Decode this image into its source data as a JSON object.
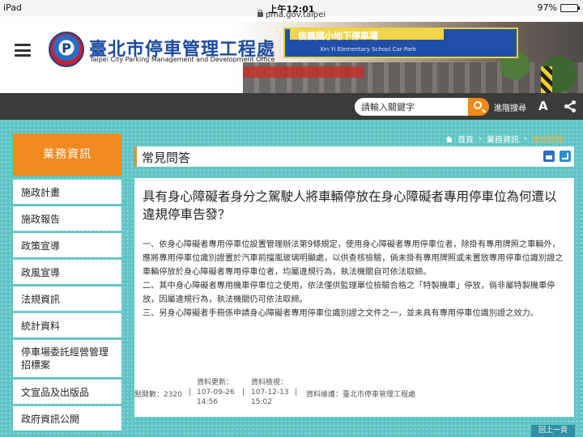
{
  "status_bar": {
    "device": "iPad",
    "time": "上午12:01",
    "battery": "97%",
    "battery_level": 0.97,
    "url": "pma.gov.taipei"
  },
  "header": {
    "site_title": "臺北市停車管理工程處",
    "site_subtitle": "Taipei City Parking Management and Development Office",
    "logo_letter": "P",
    "sign_text": "信義國小地下停車場",
    "sign_subtext": "Xin Yi Elementary School Car Park"
  },
  "toolbar": {
    "search_placeholder": "請輸入關鍵字",
    "advanced_search": "進階搜尋",
    "font_size_label": "A"
  },
  "breadcrumb": {
    "home": "首頁",
    "section": "業務資訊",
    "current": "常見問答",
    "sep": "›"
  },
  "sidebar": {
    "header": "業務資訊",
    "items": [
      {
        "label": "施政計畫"
      },
      {
        "label": "施政報告"
      },
      {
        "label": "政策宣導"
      },
      {
        "label": "政風宣導"
      },
      {
        "label": "法規資訊"
      },
      {
        "label": "統計資料"
      },
      {
        "label": "停車場委託經營管理招標案"
      },
      {
        "label": "文宣品及出版品"
      },
      {
        "label": "政府資訊公開"
      }
    ]
  },
  "page": {
    "title": "常見問答",
    "question": "具有身心障礙者身分之駕駛人將車輛停放在身心障礙者專用停車位為何遭以違規停車告發？",
    "answer": [
      "一、依身心障礙者專用停車位設置管理辦法第9條規定，使用身心障礙者專用停車位者，除掛有專用牌照之車輛外，應將專用停車位識別證置於汽車前擋風玻璃明顯處，以供查核檢驗，倘未掛有專用牌照或未置放專用停車位識別證之車輛停放於身心障礙者專用停車位者，均屬違規行為，執法機關自可依法取締。",
      "二、其中身心障礙者專用機車停車位之使用，依法僅供監理單位檢驗合格之「特製機車」停放，倘非屬特製機車停放，因屬違規行為，執法機關仍可依法取締。",
      "三、另身心障礙者手冊係申請身心障礙者專用停車位識別證之文件之一，並未具有專用停車位識別證之效力。"
    ]
  },
  "footer": {
    "views_label": "點閱數：",
    "views": "2320",
    "updated_label": "資料更新：",
    "updated_date": "107-09-26",
    "updated_time": "14:56",
    "checked_label": "資料檢視：",
    "checked_date": "107-12-13",
    "checked_time": "15:02",
    "maintainer_label": "資料維護：",
    "maintainer": "臺北市停車管理工程處",
    "pipe": "|",
    "back_button": "回上一頁"
  }
}
